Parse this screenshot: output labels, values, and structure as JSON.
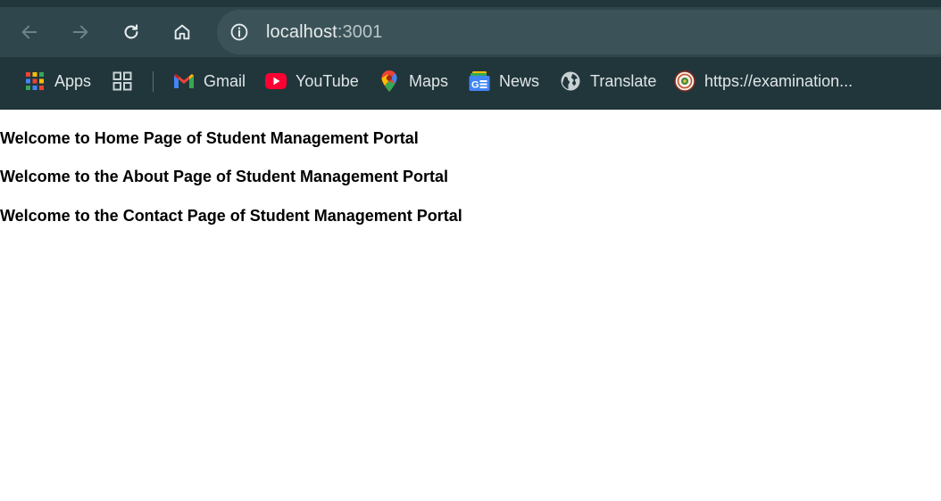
{
  "browser": {
    "url_host": "localhost",
    "url_port": ":3001",
    "bookmarks": [
      {
        "label": "Apps",
        "icon": "apps-grid-icon"
      },
      {
        "label": "",
        "icon": "tab-groups-icon"
      },
      {
        "label": "Gmail",
        "icon": "gmail-icon"
      },
      {
        "label": "YouTube",
        "icon": "youtube-icon"
      },
      {
        "label": "Maps",
        "icon": "maps-icon"
      },
      {
        "label": "News",
        "icon": "news-icon"
      },
      {
        "label": "Translate",
        "icon": "globe-icon"
      },
      {
        "label": "https://examination...",
        "icon": "site-emblem-icon"
      }
    ]
  },
  "page": {
    "headings": [
      "Welcome to Home Page of Student Management Portal",
      "Welcome to the About Page of Student Management Portal",
      "Welcome to the Contact Page of Student Management Portal"
    ]
  }
}
